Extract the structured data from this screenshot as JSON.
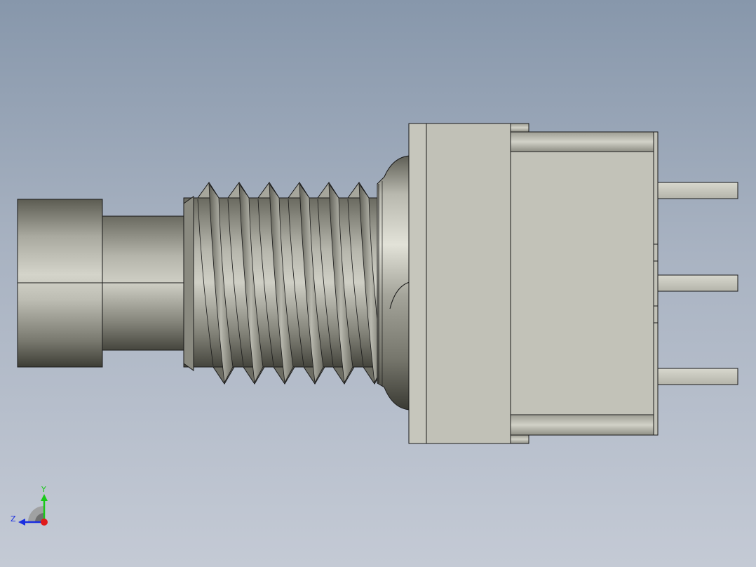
{
  "viewport": {
    "background_top": "#8797ab",
    "background_bottom": "#c4cad5"
  },
  "model": {
    "body_color": "#c2c2b8",
    "metal_light": "#d6d6cc",
    "metal_dark": "#4a4a40",
    "edge_color": "#1a1a1a"
  },
  "triad": {
    "y_label": "Y",
    "z_label": "Z",
    "y_color": "#19c919",
    "z_color": "#1a2ee0",
    "x_color": "#e01a1a"
  }
}
